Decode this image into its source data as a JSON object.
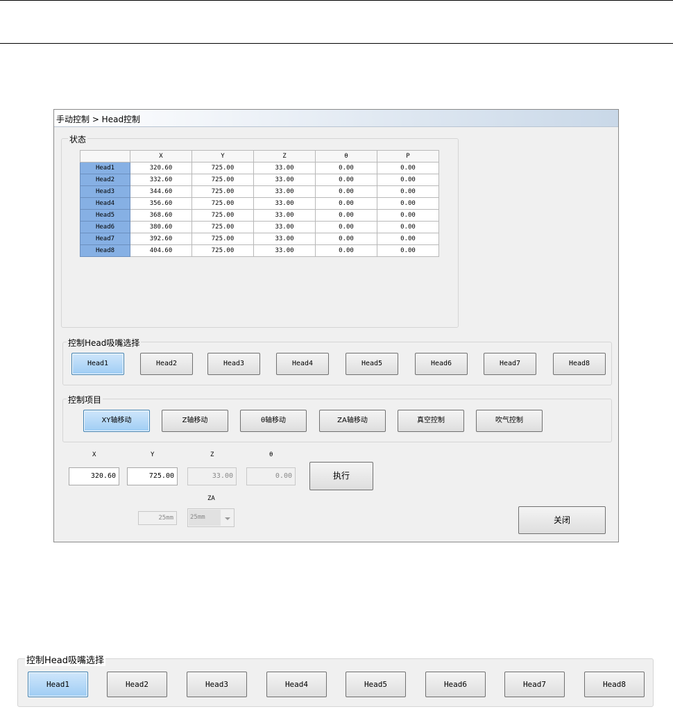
{
  "dialog": {
    "title": "手动控制 > Head控制"
  },
  "status": {
    "label": "状态",
    "columns": [
      "",
      "X",
      "Y",
      "Z",
      "θ",
      "P"
    ],
    "rows": [
      {
        "head": "Head1",
        "x": "320.60",
        "y": "725.00",
        "z": "33.00",
        "t": "0.00",
        "p": "0.00"
      },
      {
        "head": "Head2",
        "x": "332.60",
        "y": "725.00",
        "z": "33.00",
        "t": "0.00",
        "p": "0.00"
      },
      {
        "head": "Head3",
        "x": "344.60",
        "y": "725.00",
        "z": "33.00",
        "t": "0.00",
        "p": "0.00"
      },
      {
        "head": "Head4",
        "x": "356.60",
        "y": "725.00",
        "z": "33.00",
        "t": "0.00",
        "p": "0.00"
      },
      {
        "head": "Head5",
        "x": "368.60",
        "y": "725.00",
        "z": "33.00",
        "t": "0.00",
        "p": "0.00"
      },
      {
        "head": "Head6",
        "x": "380.60",
        "y": "725.00",
        "z": "33.00",
        "t": "0.00",
        "p": "0.00"
      },
      {
        "head": "Head7",
        "x": "392.60",
        "y": "725.00",
        "z": "33.00",
        "t": "0.00",
        "p": "0.00"
      },
      {
        "head": "Head8",
        "x": "404.60",
        "y": "725.00",
        "z": "33.00",
        "t": "0.00",
        "p": "0.00"
      }
    ]
  },
  "head_select": {
    "label": "控制Head吸嘴选择",
    "buttons": [
      "Head1",
      "Head2",
      "Head3",
      "Head4",
      "Head5",
      "Head6",
      "Head7",
      "Head8"
    ],
    "selected": "Head1"
  },
  "control_items": {
    "label": "控制项目",
    "buttons": [
      "XY轴移动",
      "Z轴移动",
      "θ轴移动",
      "ZA轴移动",
      "真空控制",
      "吹气控制"
    ],
    "selected": "XY轴移动"
  },
  "move": {
    "x_label": "X",
    "y_label": "Y",
    "z_label": "Z",
    "t_label": "θ",
    "za_label": "ZA",
    "x_value": "320.60",
    "y_value": "725.00",
    "z_value": "33.00",
    "t_value": "0.00",
    "za_value": "25mm",
    "za_select_value": "25mm",
    "execute_label": "执行",
    "close_label": "关闭"
  },
  "zoom_strip": {
    "label": "控制Head吸嘴选择",
    "buttons": [
      "Head1",
      "Head2",
      "Head3",
      "Head4",
      "Head5",
      "Head6",
      "Head7",
      "Head8"
    ],
    "selected": "Head1"
  },
  "colors": {
    "selected_button": "#9fcdf4",
    "row_header": "#86b0e4",
    "dialog_bg": "#f0f0f0"
  }
}
